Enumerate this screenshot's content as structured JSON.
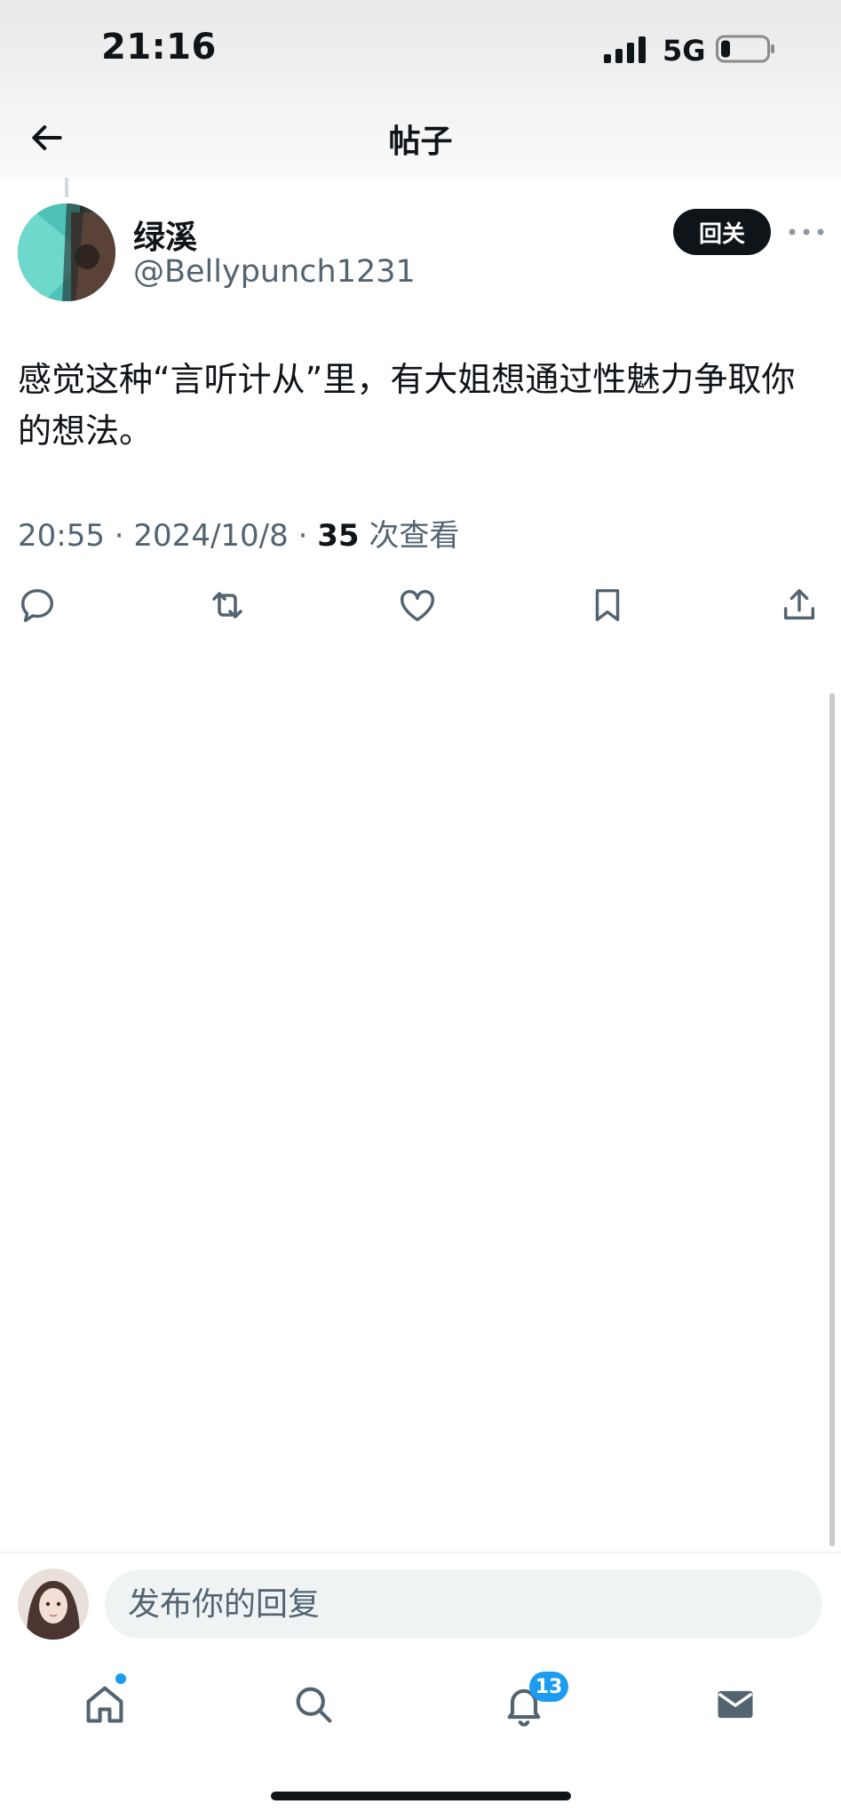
{
  "status_bar": {
    "time": "21:16",
    "network": "5G"
  },
  "header": {
    "title": "帖子"
  },
  "post": {
    "author": {
      "name": "绿溪",
      "handle": "@Bellypunch1231"
    },
    "follow_label": "回关",
    "text": "感觉这种“言听计从”里，有大姐想通过性魅力争取你的想法。",
    "time": "20:55",
    "date": "2024/10/8",
    "view_count": "35",
    "view_label": "次查看",
    "actions": [
      "reply-icon",
      "repost-icon",
      "like-icon",
      "bookmark-icon",
      "share-icon"
    ]
  },
  "reply": {
    "placeholder": "发布你的回复"
  },
  "bottom_nav": {
    "items": [
      "home-icon",
      "search-icon",
      "notifications-icon",
      "messages-icon"
    ],
    "notification_badge": "13"
  },
  "colors": {
    "accent": "#1d9bf0",
    "text": "#0f1419",
    "muted": "#536471",
    "input_bg": "#eff3f4"
  }
}
